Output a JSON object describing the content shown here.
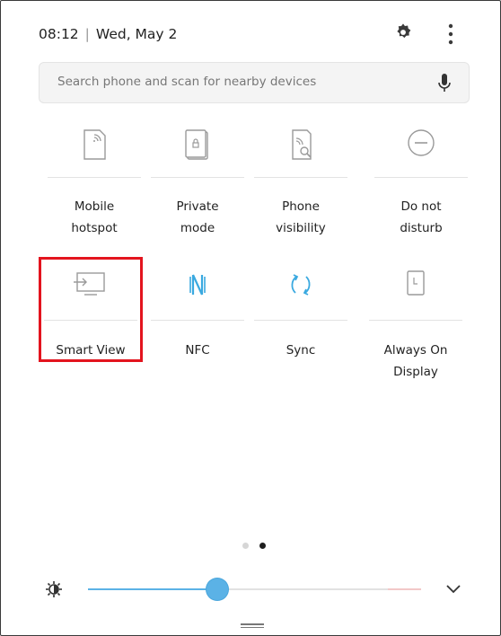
{
  "status": {
    "time": "08:12",
    "separator": "|",
    "date": "Wed, May 2"
  },
  "header_icons": [
    "gear-icon",
    "more-vertical-icon"
  ],
  "search": {
    "placeholder": "Search phone and scan for nearby devices",
    "icon": "mic-icon"
  },
  "tiles_row1": [
    {
      "line1": "Mobile",
      "line2": "hotspot",
      "icon": "mobile-hotspot-icon",
      "active": false
    },
    {
      "line1": "Private",
      "line2": "mode",
      "icon": "private-mode-icon",
      "active": false
    },
    {
      "line1": "Phone",
      "line2": "visibility",
      "icon": "phone-visibility-icon",
      "active": false
    },
    {
      "line1": "Do not",
      "line2": "disturb",
      "icon": "do-not-disturb-icon",
      "active": false
    }
  ],
  "tiles_row2": [
    {
      "line1": "Smart View",
      "line2": "",
      "icon": "smart-view-icon",
      "active": false
    },
    {
      "line1": "NFC",
      "line2": "",
      "icon": "nfc-icon",
      "active": true
    },
    {
      "line1": "Sync",
      "line2": "",
      "icon": "sync-icon",
      "active": true
    },
    {
      "line1": "Always On",
      "line2": "Display",
      "icon": "always-on-display-icon",
      "active": false
    }
  ],
  "highlighted_tile": "Smart View",
  "pager": {
    "pages": 2,
    "current": 2
  },
  "brightness": {
    "level": 0.39,
    "icon": "brightness-icon"
  },
  "colors": {
    "accent": "#5bb2e6",
    "highlight": "#e3141e",
    "inactive_icon": "#9a9a9a"
  }
}
